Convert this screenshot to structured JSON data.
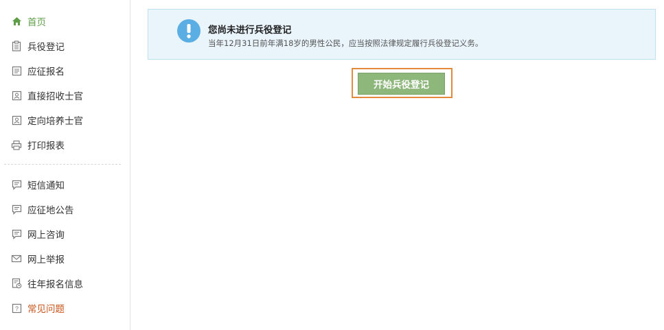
{
  "sidebar": {
    "items": [
      {
        "label": "首页",
        "icon": "home-icon"
      },
      {
        "label": "兵役登记",
        "icon": "clipboard-icon"
      },
      {
        "label": "应征报名",
        "icon": "document-icon"
      },
      {
        "label": "直接招收士官",
        "icon": "id-card-icon"
      },
      {
        "label": "定向培养士官",
        "icon": "id-card-icon"
      },
      {
        "label": "打印报表",
        "icon": "printer-icon"
      },
      {
        "label": "短信通知",
        "icon": "message-icon"
      },
      {
        "label": "应征地公告",
        "icon": "message-icon"
      },
      {
        "label": "网上咨询",
        "icon": "message-icon"
      },
      {
        "label": "网上举报",
        "icon": "envelope-icon"
      },
      {
        "label": "往年报名信息",
        "icon": "history-icon"
      },
      {
        "label": "常见问题",
        "icon": "question-icon"
      }
    ],
    "active_color": "#5f9e49",
    "faq_color": "#c8541a"
  },
  "notice": {
    "title": "您尚未进行兵役登记",
    "text": "当年12月31日前年满18岁的男性公民，应当按照法律规定履行兵役登记义务。",
    "icon": "exclamation-icon",
    "background": "#e9f4fb",
    "icon_color": "#5aaee3"
  },
  "actions": {
    "start_label": "开始兵役登记",
    "button_color": "#8db77b",
    "highlight_color": "#e2893a"
  }
}
